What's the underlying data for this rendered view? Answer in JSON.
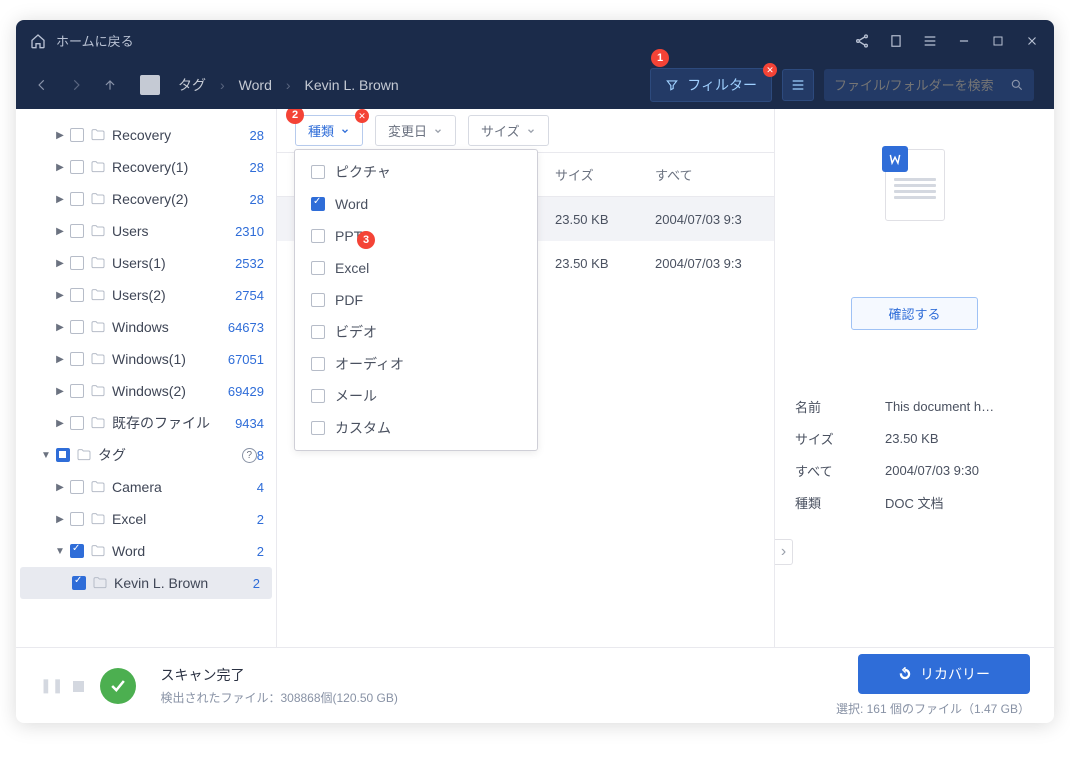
{
  "titlebar": {
    "home": "ホームに戻る"
  },
  "breadcrumb": {
    "root": "タグ",
    "level1": "Word",
    "level2": "Kevin L. Brown"
  },
  "filter_button": "フィルター",
  "search_placeholder": "ファイル/フォルダーを検索",
  "toolbar": {
    "type": "種類 ",
    "date": "変更日 ",
    "size": "サイズ "
  },
  "dropdown": {
    "items": [
      {
        "label": "ピクチャ",
        "checked": false
      },
      {
        "label": "Word",
        "checked": true
      },
      {
        "label": "PPT",
        "checked": false
      },
      {
        "label": "Excel",
        "checked": false
      },
      {
        "label": "PDF",
        "checked": false
      },
      {
        "label": "ビデオ",
        "checked": false
      },
      {
        "label": "オーディオ",
        "checked": false
      },
      {
        "label": "メール",
        "checked": false
      },
      {
        "label": "カスタム",
        "checked": false
      }
    ]
  },
  "annotations": {
    "n1": "1",
    "n2": "2",
    "n3": "3"
  },
  "tree": [
    {
      "label": "Recovery",
      "count": "28",
      "indent": 1,
      "caret": "▶"
    },
    {
      "label": "Recovery(1)",
      "count": "28",
      "indent": 1,
      "caret": "▶"
    },
    {
      "label": "Recovery(2)",
      "count": "28",
      "indent": 1,
      "caret": "▶"
    },
    {
      "label": "Users",
      "count": "2310",
      "indent": 1,
      "caret": "▶"
    },
    {
      "label": "Users(1)",
      "count": "2532",
      "indent": 1,
      "caret": "▶"
    },
    {
      "label": "Users(2)",
      "count": "2754",
      "indent": 1,
      "caret": "▶"
    },
    {
      "label": "Windows",
      "count": "64673",
      "indent": 1,
      "caret": "▶"
    },
    {
      "label": "Windows(1)",
      "count": "67051",
      "indent": 1,
      "caret": "▶"
    },
    {
      "label": "Windows(2)",
      "count": "69429",
      "indent": 1,
      "caret": "▶"
    },
    {
      "label": "既存のファイル",
      "count": "9434",
      "indent": 1,
      "caret": "▶"
    },
    {
      "label": "タグ",
      "count": "8",
      "indent": 0,
      "caret": "▼",
      "help": true,
      "chk": "partial"
    },
    {
      "label": "Camera",
      "count": "4",
      "indent": 1,
      "caret": "▶"
    },
    {
      "label": "Excel",
      "count": "2",
      "indent": 1,
      "caret": "▶"
    },
    {
      "label": "Word",
      "count": "2",
      "indent": 1,
      "caret": "▼",
      "chk": "checked"
    },
    {
      "label": "Kevin L. Brown",
      "count": "2",
      "indent": 2,
      "selected": true,
      "chk": "checked"
    }
  ],
  "table": {
    "headers": {
      "size": "サイズ",
      "all": "すべて"
    },
    "rows": [
      {
        "size": "23.50 KB",
        "date": "2004/07/03 9:3"
      },
      {
        "size": "23.50 KB",
        "date": "2004/07/03 9:3"
      }
    ]
  },
  "details": {
    "confirm": "確認する",
    "fields": [
      {
        "k": "名前",
        "v": "This document h…"
      },
      {
        "k": "サイズ",
        "v": "23.50 KB"
      },
      {
        "k": "すべて",
        "v": "2004/07/03 9:30"
      },
      {
        "k": "種類",
        "v": "DOC 文档"
      }
    ]
  },
  "footer": {
    "title": "スキャン完了",
    "subtitle": "検出されたファイル：308868個(120.50 GB)",
    "recover": "リカバリー",
    "selection": "選択: 161 個のファイル（1.47 GB）"
  }
}
